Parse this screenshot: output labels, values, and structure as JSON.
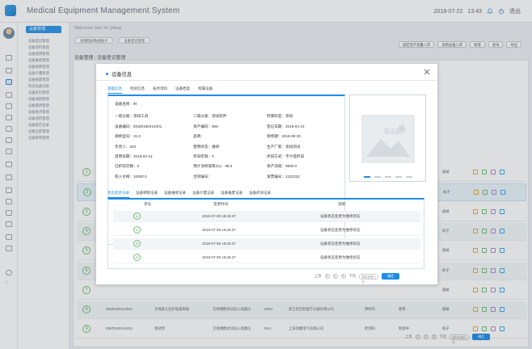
{
  "header": {
    "title": "Medical Equipment Management System",
    "date": "2018-07-22",
    "time": "13:43",
    "logout": "退出"
  },
  "menu": {
    "head": "设备管理",
    "items": [
      "设备登记管理",
      "设备资料管理",
      "设备使用管理",
      "设备维修管理",
      "设备保养管理",
      "设备计量管理",
      "设备报废管理",
      "科室设备分配",
      "设备折旧管理",
      "设备调拨管理",
      "设备借用管理",
      "设备盘点管理",
      "设备巡检管理",
      "设备报告记录",
      "设备出库管理",
      "设备移库管理"
    ]
  },
  "main": {
    "welcome": "Welcome Sun Ye Qiang",
    "tabs": [
      "关键指标数据统计",
      "设备登记管理"
    ],
    "breadcrumb": "设备管理 - 设备登记管理",
    "toolbar": [
      "固定资产批量入库",
      "采购设备入库",
      "新增",
      "查询",
      "导出"
    ],
    "rows": [
      {
        "no": "1",
        "code": "",
        "name": "",
        "type": "",
        "brand": "",
        "maker": "",
        "dept": "",
        "status": "",
        "cls": "器械"
      },
      {
        "no": "2",
        "code": "",
        "name": "",
        "type": "",
        "brand": "",
        "maker": "",
        "dept": "",
        "status": "",
        "cls": "样子"
      },
      {
        "no": "3",
        "code": "",
        "name": "",
        "type": "",
        "brand": "",
        "maker": "",
        "dept": "",
        "status": "",
        "cls": "器械"
      },
      {
        "no": "4",
        "code": "",
        "name": "",
        "type": "",
        "brand": "",
        "maker": "",
        "dept": "",
        "status": "",
        "cls": "样子"
      },
      {
        "no": "5",
        "code": "",
        "name": "",
        "type": "",
        "brand": "",
        "maker": "",
        "dept": "",
        "status": "",
        "cls": "器械"
      },
      {
        "no": "6",
        "code": "",
        "name": "",
        "type": "",
        "brand": "",
        "maker": "",
        "dept": "",
        "status": "",
        "cls": "样子"
      },
      {
        "no": "7",
        "code": "",
        "name": "",
        "type": "",
        "brand": "",
        "maker": "",
        "dept": "",
        "status": "",
        "cls": "器械"
      },
      {
        "no": "8",
        "code": "EMZ0180414001",
        "name": "无线胎儿监护电极系统",
        "type": "无线便携式动态心电图仪",
        "brand": "MNH",
        "maker": "浙江宏佳利医疗仪器有限公司",
        "dept": "神经科",
        "status": "使用",
        "cls": "器械"
      },
      {
        "no": "9",
        "code": "EMZ0180414001",
        "name": "测试用",
        "type": "无线便携式动态心电图仪",
        "brand": "EKA",
        "maker": "上海领康电气有限公司",
        "dept": "检测科",
        "status": "制造中",
        "cls": "样子"
      }
    ],
    "pager": {
      "prev": "上页",
      "next": "下页",
      "pages": [
        "1",
        "2",
        "3"
      ],
      "placeholder": "跳转到第几页",
      "go": "确定"
    }
  },
  "modal": {
    "title": "设备信息",
    "tabs": [
      "基础信息",
      "检验信息",
      "技术资料",
      "设备档案",
      "附属设备"
    ],
    "info": [
      [
        "设备名称：lR",
        "",
        ""
      ],
      [
        "一级分类：测试工具",
        "二级分类：测试软件",
        "所属科室：测试"
      ],
      [
        "设备编码：EMZ0180414001",
        "资产编码：555",
        "登记日期：2018-04-13"
      ],
      [
        "规格型号：31.0",
        "品牌：",
        "保修期：2018-09-30"
      ],
      [
        "负责人：333",
        "使用状态：维修",
        "生产厂家：测试测试"
      ],
      [
        "启用日期：2018-04-13",
        "折旧年限：0",
        "折旧方式：不计提折旧"
      ],
      [
        "已折旧次数：0",
        "预计净残值率(%)：95.0",
        "资产净值：9500.0"
      ],
      [
        "购入价格：10000.0",
        "合同编号：",
        "发票编号：2222222"
      ]
    ],
    "image_placeholder": "暂无图片",
    "history_tabs": [
      "状态变更记录",
      "设备转移记录",
      "设备维修记录",
      "设备计量记录",
      "设备报废记录",
      "设备折旧记录"
    ],
    "history_headers": [
      "序号",
      "变更时间",
      "说明"
    ],
    "history": [
      {
        "no": "1",
        "time": "2018-07-05 16:26:27",
        "desc": "设备状态变更为维修状态"
      },
      {
        "no": "2",
        "time": "2018-07-05 16:26:27",
        "desc": "设备状态变更为维修状态"
      },
      {
        "no": "3",
        "time": "2018-07-05 16:26:27",
        "desc": "设备状态变更为维修状态"
      },
      {
        "no": "4",
        "time": "2018-07-05 16:26:27",
        "desc": "设备状态变更为维修状态"
      }
    ],
    "pager": {
      "prev": "上页",
      "next": "下页",
      "pages": [
        "1",
        "2",
        "3"
      ],
      "placeholder": "跳转到第几页",
      "go": "确定"
    }
  },
  "colors": {
    "accent": "#1f8ce6",
    "ok": "#6fbf73"
  }
}
